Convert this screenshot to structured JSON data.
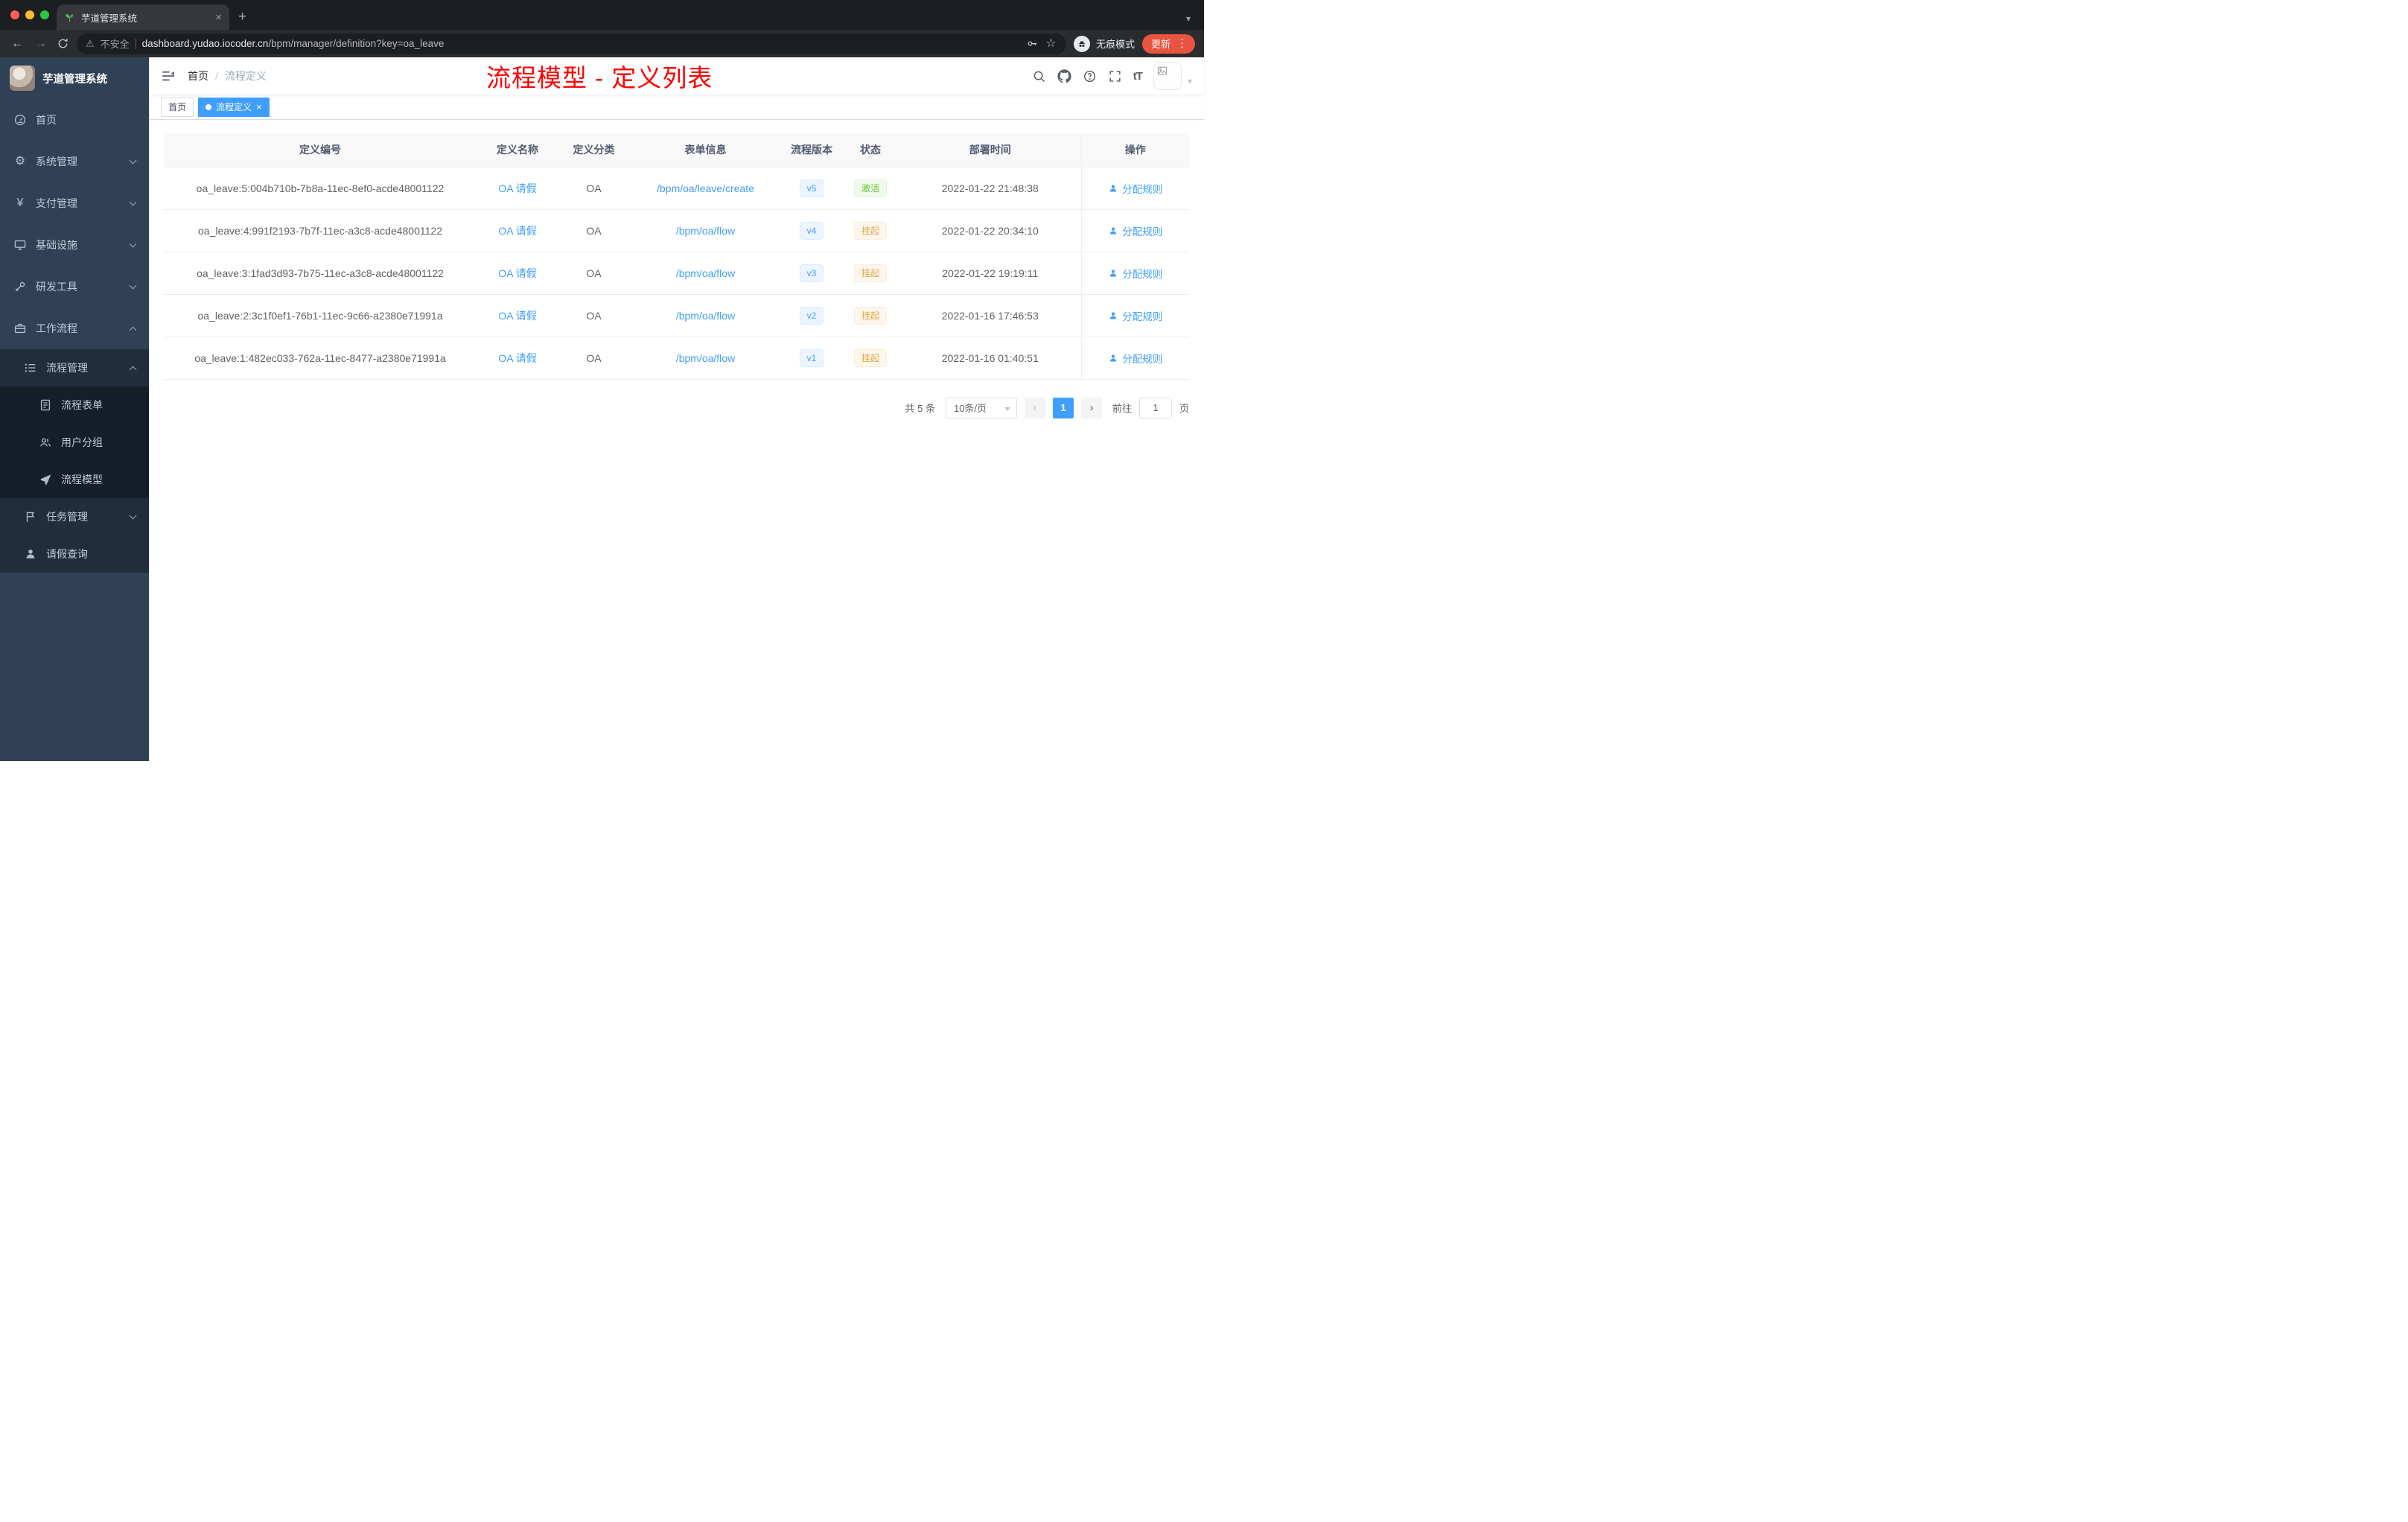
{
  "browser": {
    "tab_title": "芋道管理系统",
    "security_label": "不安全",
    "url_host": "dashboard.yudao.iocoder.cn",
    "url_path": "/bpm/manager/definition?key=oa_leave",
    "incognito_label": "无痕模式",
    "update_label": "更新"
  },
  "icons": {
    "gear-icon": "⚙",
    "yen-icon": "¥",
    "warning-icon": "⚠",
    "star-icon": "☆",
    "font-size-icon": "tT",
    "kebab-icon": "⋮",
    "plus-icon": "+",
    "close-icon": "×",
    "caret-down-icon": "▾",
    "back-icon": "←",
    "forward-icon": "→"
  },
  "sidebar": {
    "logo_title": "芋道管理系统",
    "menu": [
      {
        "key": "home",
        "label": "首页",
        "icon": "dashboard-icon",
        "level": 1,
        "chevron": ""
      },
      {
        "key": "system",
        "label": "系统管理",
        "icon": "gear-icon",
        "level": 1,
        "chevron": "down"
      },
      {
        "key": "payment",
        "label": "支付管理",
        "icon": "yen-icon",
        "level": 1,
        "chevron": "down"
      },
      {
        "key": "infrastructure",
        "label": "基础设施",
        "icon": "monitor-icon",
        "level": 1,
        "chevron": "down"
      },
      {
        "key": "devtools",
        "label": "研发工具",
        "icon": "tools-icon",
        "level": 1,
        "chevron": "down"
      },
      {
        "key": "workflow",
        "label": "工作流程",
        "icon": "briefcase-icon",
        "level": 1,
        "chevron": "up"
      },
      {
        "key": "process-management",
        "label": "流程管理",
        "icon": "list-icon",
        "level": 2,
        "chevron": "up"
      },
      {
        "key": "process-form",
        "label": "流程表单",
        "icon": "form-icon",
        "level": 3,
        "chevron": ""
      },
      {
        "key": "user-group",
        "label": "用户分组",
        "icon": "users-icon",
        "level": 3,
        "chevron": ""
      },
      {
        "key": "process-model",
        "label": "流程模型",
        "icon": "send-icon",
        "level": 3,
        "chevron": ""
      },
      {
        "key": "task-management",
        "label": "任务管理",
        "icon": "task-icon",
        "level": 2,
        "chevron": "down"
      },
      {
        "key": "leave-query",
        "label": "请假查询",
        "icon": "user-icon",
        "level": 2,
        "chevron": ""
      }
    ]
  },
  "header": {
    "breadcrumb": [
      "首页",
      "流程定义"
    ],
    "breadcrumb_separator": "/",
    "annotation": "流程模型 - 定义列表"
  },
  "tags": [
    {
      "label": "首页",
      "active": false
    },
    {
      "label": "流程定义",
      "active": true
    }
  ],
  "table": {
    "columns": [
      "定义编号",
      "定义名称",
      "定义分类",
      "表单信息",
      "流程版本",
      "状态",
      "部署时间",
      "操作"
    ],
    "rows": [
      {
        "id": "oa_leave:5:004b710b-7b8a-11ec-8ef0-acde48001122",
        "name": "OA 请假",
        "category": "OA",
        "form": "/bpm/oa/leave/create",
        "version": "v5",
        "status": "激活",
        "status_type": "success",
        "deploy_time": "2022-01-22 21:48:38",
        "action": "分配规则"
      },
      {
        "id": "oa_leave:4:991f2193-7b7f-11ec-a3c8-acde48001122",
        "name": "OA 请假",
        "category": "OA",
        "form": "/bpm/oa/flow",
        "version": "v4",
        "status": "挂起",
        "status_type": "warning",
        "deploy_time": "2022-01-22 20:34:10",
        "action": "分配规则"
      },
      {
        "id": "oa_leave:3:1fad3d93-7b75-11ec-a3c8-acde48001122",
        "name": "OA 请假",
        "category": "OA",
        "form": "/bpm/oa/flow",
        "version": "v3",
        "status": "挂起",
        "status_type": "warning",
        "deploy_time": "2022-01-22 19:19:11",
        "action": "分配规则"
      },
      {
        "id": "oa_leave:2:3c1f0ef1-76b1-11ec-9c66-a2380e71991a",
        "name": "OA 请假",
        "category": "OA",
        "form": "/bpm/oa/flow",
        "version": "v2",
        "status": "挂起",
        "status_type": "warning",
        "deploy_time": "2022-01-16 17:46:53",
        "action": "分配规则"
      },
      {
        "id": "oa_leave:1:482ec033-762a-11ec-8477-a2380e71991a",
        "name": "OA 请假",
        "category": "OA",
        "form": "/bpm/oa/flow",
        "version": "v1",
        "status": "挂起",
        "status_type": "warning",
        "deploy_time": "2022-01-16 01:40:51",
        "action": "分配规则"
      }
    ]
  },
  "pagination": {
    "total_label": "共 5 条",
    "page_size_label": "10条/页",
    "prev_glyph": "‹",
    "current_page": "1",
    "next_glyph": "›",
    "goto_label": "前往",
    "goto_value": "1",
    "page_unit": "页"
  },
  "colors": {
    "accent_blue": "#409eff",
    "success_green": "#67c23a",
    "warning_orange": "#e6a23c",
    "annotation_red": "#ff0000",
    "sidebar_bg": "#304156",
    "submenu_bg": "#1f2d3d",
    "submenu_deep_bg": "#141f29"
  }
}
